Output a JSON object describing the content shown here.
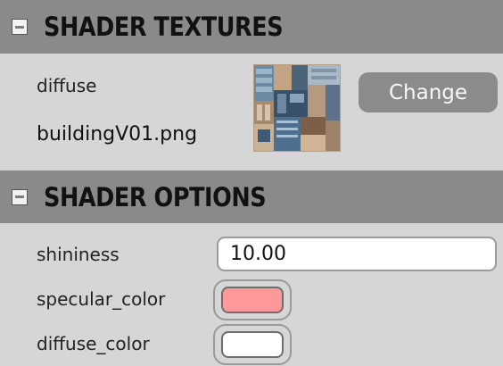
{
  "textures_section": {
    "title": "SHADER TEXTURES",
    "texture_label": "diffuse",
    "texture_filename": "buildingV01.png",
    "change_button": "Change"
  },
  "options_section": {
    "title": "SHADER OPTIONS",
    "shininess_label": "shininess",
    "shininess_value": "10.00",
    "specular_label": "specular_color",
    "specular_color": "#ff9999",
    "diffuse_label": "diffuse_color",
    "diffuse_color": "#ffffff"
  },
  "colors": {
    "header_bg": "#8a8a8a",
    "panel_bg": "#d6d6d6",
    "button_bg": "#8b8b8b"
  }
}
